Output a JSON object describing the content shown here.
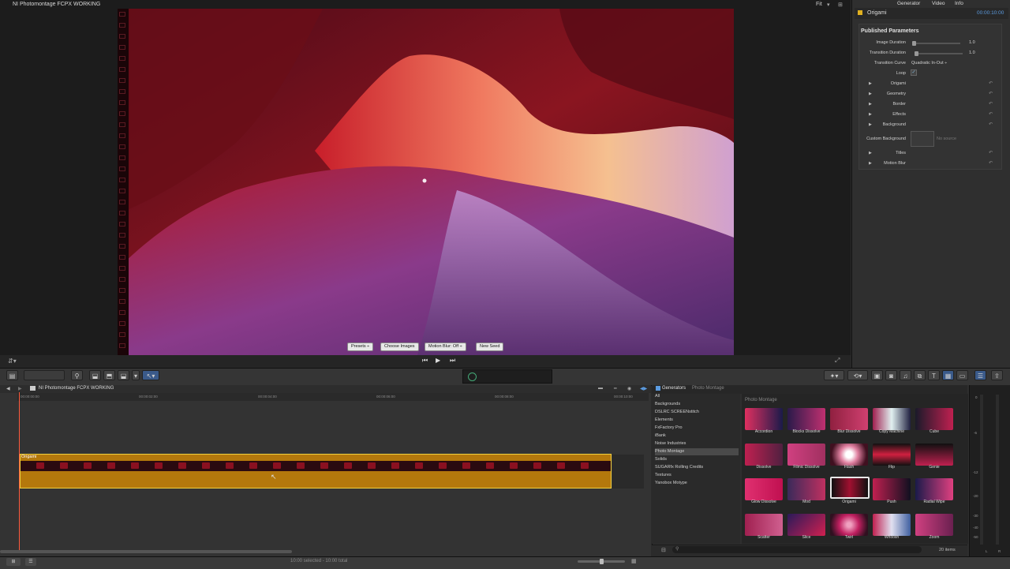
{
  "viewer": {
    "title": "NI Photomontage FCPX WORKING",
    "zoom": "Fit",
    "overlay_buttons": [
      "Presets ÷",
      "Choose Images",
      "Motion Blur: Off ÷",
      "New Seed"
    ]
  },
  "inspector": {
    "tabs": [
      "Generator",
      "Video",
      "Info"
    ],
    "generator_name": "Origami",
    "timecode": "00:00:10:00",
    "section_title": "Published Parameters",
    "params": [
      {
        "label": "Image Duration",
        "value": "1.0",
        "level": 0.05
      },
      {
        "label": "Transition Duration",
        "value": "1.0",
        "level": 0.05
      },
      {
        "label": "Transition Curve",
        "value": "Quadratic In-Out ÷"
      },
      {
        "label": "Loop",
        "value": "✓"
      }
    ],
    "groups": [
      "Origami",
      "Geometry",
      "Border",
      "Effects",
      "Background"
    ],
    "custom_background_label": "Custom Background",
    "custom_background_value": "No source",
    "groups2": [
      "Titles",
      "Motion Blur"
    ]
  },
  "timeline": {
    "project": "NI Photomontage FCPX WORKING",
    "ruler": [
      "00:00:00:00",
      "00:00:02:00",
      "00:00:04:00",
      "00:00:06:00",
      "00:00:08:00",
      "00:00:10:00"
    ],
    "clip_name": "Origami"
  },
  "browser": {
    "header": "Generators",
    "header_sub": "Photo Montage",
    "categories": [
      "All",
      "Backgrounds",
      "DSLRC SCREENstitch",
      "Elements",
      "FxFactory Pro",
      "iBank",
      "Noise Industries",
      "Photo Montage",
      "Solids",
      "SUGARfx Rolling Credits",
      "Textures",
      "Yanobox Motype"
    ],
    "selected_category": "Photo Montage",
    "group_title": "Photo Montage",
    "items": [
      "Accordion",
      "Blocks Dissolve",
      "Blur Dissolve",
      "Copy Machine",
      "Cube",
      "Dissolve",
      "Filmic Dissolve",
      "Flash",
      "Flip",
      "Genie",
      "Glow Dissolve",
      "Mod",
      "Origami",
      "Push",
      "Radial Wipe",
      "Scatter",
      "Slice",
      "Twirl",
      "Whoosh",
      "Zoom"
    ],
    "selected_item": "Origami",
    "count": "20 items"
  },
  "meters": {
    "labels": [
      "0",
      "-6",
      "-12",
      "-20",
      "-30",
      "-40",
      "-50",
      "L",
      "R"
    ]
  },
  "status": "10:00 selected - 10:00 total",
  "colors": {
    "accent": "#5b9be0",
    "clip": "#b4780c",
    "clip_border": "#f0d040",
    "playhead": "#ff5a3c"
  }
}
